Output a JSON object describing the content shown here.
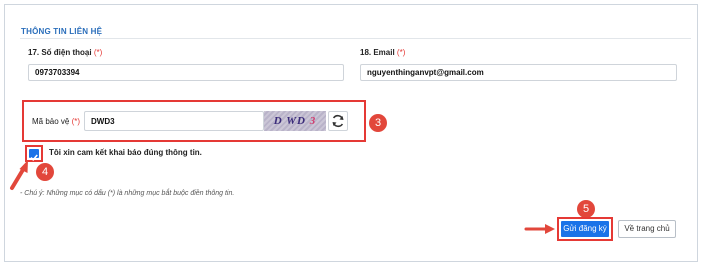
{
  "section": {
    "title": "THÔNG TIN LIÊN HỆ"
  },
  "phone": {
    "label": "17. Số điện thoại",
    "required_mark": "(*)",
    "value": "0973703394"
  },
  "email": {
    "label": "18. Email",
    "required_mark": "(*)",
    "value": "nguyenthinganvpt@gmail.com"
  },
  "captcha": {
    "label": "Mã bảo vệ",
    "required_mark": "(*)",
    "value": "DWD3",
    "image_text": "D WD",
    "image_text_last": "3"
  },
  "commitment": {
    "label": "Tôi xin cam kết khai báo đúng thông tin.",
    "checked": true
  },
  "note": {
    "text": "- Chú ý: Những mục có dấu (*) là những mục bắt buộc điền thông tin."
  },
  "buttons": {
    "submit": "Gửi đăng ký",
    "home": "Về trang chủ"
  },
  "annotations": {
    "step3": "3",
    "step4": "4",
    "step5": "5"
  },
  "colors": {
    "accent": "#1a73e8",
    "highlight": "#e53935",
    "title": "#2a6ebb"
  }
}
